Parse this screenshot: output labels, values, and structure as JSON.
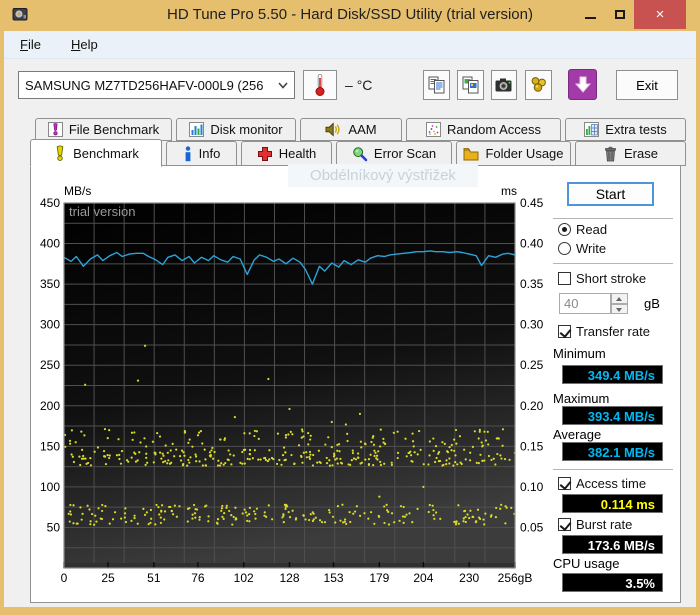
{
  "window": {
    "title": "HD Tune Pro 5.50 - Hard Disk/SSD Utility (trial version)",
    "close_glyph": "×"
  },
  "menu": {
    "items": [
      "File",
      "Help"
    ]
  },
  "toolbar": {
    "drive_select": "SAMSUNG MZ7TD256HAFV-000L9 (256",
    "temperature_value": "–",
    "temperature_unit": "°C",
    "exit_label": "Exit"
  },
  "tabs": {
    "row1": [
      {
        "label": "File Benchmark",
        "icon": "file-benchmark-icon"
      },
      {
        "label": "Disk monitor",
        "icon": "disk-monitor-icon"
      },
      {
        "label": "AAM",
        "icon": "aam-icon"
      },
      {
        "label": "Random Access",
        "icon": "random-access-icon"
      },
      {
        "label": "Extra tests",
        "icon": "extra-tests-icon"
      }
    ],
    "row2": [
      {
        "label": "Benchmark",
        "icon": "benchmark-icon",
        "active": true
      },
      {
        "label": "Info",
        "icon": "info-icon"
      },
      {
        "label": "Health",
        "icon": "health-icon"
      },
      {
        "label": "Error Scan",
        "icon": "error-scan-icon"
      },
      {
        "label": "Folder Usage",
        "icon": "folder-usage-icon"
      },
      {
        "label": "Erase",
        "icon": "erase-icon"
      }
    ]
  },
  "watermark": "Obdélníkový výstřižek",
  "panel": {
    "start": "Start",
    "read": "Read",
    "write": "Write",
    "short_stroke": "Short stroke",
    "short_stroke_value": "40",
    "short_stroke_unit": "gB",
    "transfer_rate": "Transfer rate",
    "minimum_label": "Minimum",
    "minimum": "349.4 MB/s",
    "maximum_label": "Maximum",
    "maximum": "393.4 MB/s",
    "average_label": "Average",
    "average": "382.1 MB/s",
    "access_time_label": "Access time",
    "access_time": "0.114 ms",
    "burst_rate_label": "Burst rate",
    "burst_rate": "173.6 MB/s",
    "cpu_label": "CPU usage",
    "cpu": "3.5%"
  },
  "chart_data": {
    "type": "line+scatter",
    "trial_text": "trial version",
    "left_axis": {
      "label": "MB/s",
      "range": [
        0,
        450
      ],
      "tick_values": [
        450,
        400,
        350,
        300,
        250,
        200,
        150,
        100,
        50
      ]
    },
    "right_axis": {
      "label": "ms",
      "range": [
        0,
        0.45
      ],
      "tick_labels": [
        "0.45",
        "0.40",
        "0.35",
        "0.30",
        "0.25",
        "0.20",
        "0.15",
        "0.10",
        "0.05"
      ]
    },
    "x_axis": {
      "range": [
        0,
        256
      ],
      "tick_values": [
        0,
        25,
        51,
        76,
        102,
        128,
        153,
        179,
        204,
        230,
        256
      ],
      "tick_labels": [
        "0",
        "25",
        "51",
        "76",
        "102",
        "128",
        "153",
        "179",
        "204",
        "230",
        "256gB"
      ]
    },
    "grid": {
      "v_divisions": 15,
      "h_step": 25
    },
    "plot_colors": {
      "bg_top": "#000000",
      "bg_bottom": "#3c3c3c",
      "grid": "#4f4f4f",
      "border": "#8a8a8a"
    },
    "transfer_rate_line": {
      "name": "Transfer rate",
      "unit": "MB/s",
      "color": "#2ba3da",
      "points": [
        [
          0,
          383
        ],
        [
          4,
          378
        ],
        [
          7,
          384
        ],
        [
          11,
          372
        ],
        [
          15,
          381
        ],
        [
          19,
          386
        ],
        [
          22,
          379
        ],
        [
          26,
          385
        ],
        [
          30,
          389
        ],
        [
          33,
          384
        ],
        [
          37,
          387
        ],
        [
          41,
          388
        ],
        [
          45,
          388
        ],
        [
          48,
          384
        ],
        [
          52,
          380
        ],
        [
          56,
          374
        ],
        [
          59,
          383
        ],
        [
          63,
          386
        ],
        [
          67,
          379
        ],
        [
          71,
          384
        ],
        [
          74,
          376
        ],
        [
          78,
          383
        ],
        [
          82,
          379
        ],
        [
          85,
          385
        ],
        [
          89,
          380
        ],
        [
          93,
          377
        ],
        [
          96,
          384
        ],
        [
          100,
          381
        ],
        [
          104,
          362
        ],
        [
          108,
          380
        ],
        [
          111,
          386
        ],
        [
          115,
          383
        ],
        [
          119,
          378
        ],
        [
          122,
          381
        ],
        [
          126,
          375
        ],
        [
          130,
          382
        ],
        [
          134,
          377
        ],
        [
          137,
          368
        ],
        [
          141,
          350
        ],
        [
          145,
          372
        ],
        [
          148,
          366
        ],
        [
          152,
          376
        ],
        [
          156,
          371
        ],
        [
          159,
          379
        ],
        [
          163,
          374
        ],
        [
          167,
          380
        ],
        [
          171,
          377
        ],
        [
          174,
          382
        ],
        [
          178,
          385
        ],
        [
          182,
          384
        ],
        [
          185,
          386
        ],
        [
          189,
          387
        ],
        [
          193,
          388
        ],
        [
          197,
          389
        ],
        [
          200,
          390
        ],
        [
          204,
          390
        ],
        [
          208,
          391
        ],
        [
          211,
          390
        ],
        [
          215,
          390
        ],
        [
          219,
          389
        ],
        [
          223,
          390
        ],
        [
          226,
          389
        ],
        [
          230,
          387
        ],
        [
          234,
          385
        ],
        [
          237,
          373
        ],
        [
          241,
          385
        ],
        [
          245,
          383
        ],
        [
          249,
          387
        ],
        [
          252,
          388
        ],
        [
          256,
          386
        ]
      ]
    },
    "access_time_scatter": {
      "name": "Access time",
      "unit": "ms",
      "color": "#dcdc28",
      "seed": 1337,
      "bands": [
        {
          "ms_min": 0.126,
          "ms_max": 0.146,
          "count": 250
        },
        {
          "ms_min": 0.148,
          "ms_max": 0.172,
          "count": 115
        },
        {
          "ms_min": 0.053,
          "ms_max": 0.078,
          "count": 230
        }
      ],
      "outliers": [
        [
          12,
          0.226
        ],
        [
          42,
          0.231
        ],
        [
          46,
          0.274
        ],
        [
          97,
          0.186
        ],
        [
          116,
          0.233
        ],
        [
          128,
          0.196
        ],
        [
          152,
          0.18
        ],
        [
          160,
          0.177
        ],
        [
          168,
          0.19
        ],
        [
          179,
          0.088
        ],
        [
          204,
          0.1
        ],
        [
          236,
          0.168
        ]
      ]
    }
  }
}
